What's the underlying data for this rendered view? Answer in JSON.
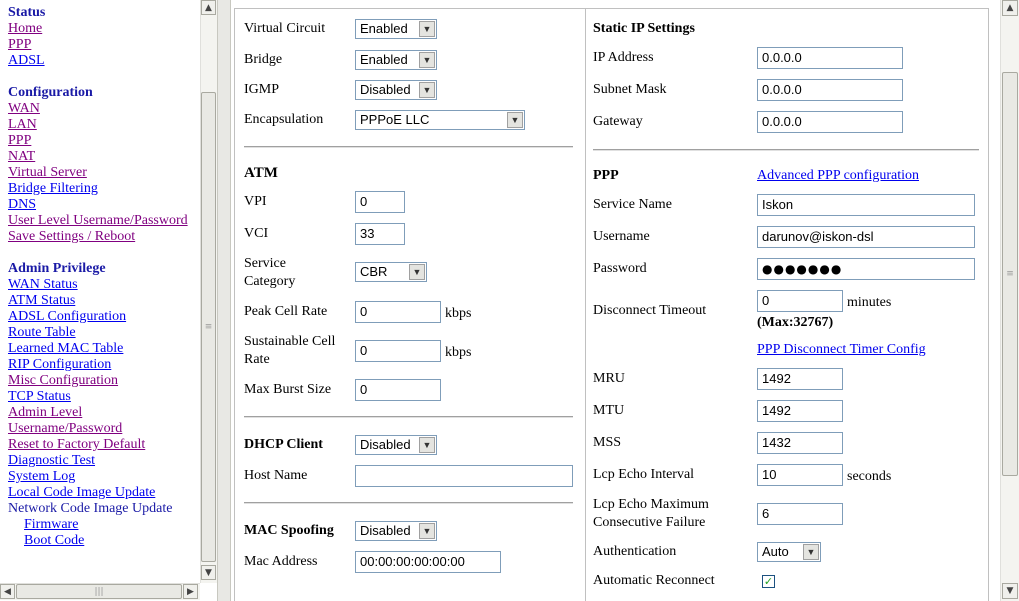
{
  "sidebar": {
    "status": {
      "title": "Status",
      "items": [
        "Home",
        "PPP",
        "ADSL"
      ]
    },
    "configuration": {
      "title": "Configuration",
      "items": [
        "WAN",
        "LAN",
        "PPP",
        "NAT",
        "Virtual Server",
        "Bridge Filtering",
        "DNS",
        "User Level Username/Password",
        "Save Settings / Reboot"
      ]
    },
    "admin": {
      "title": "Admin Privilege",
      "items": [
        "WAN Status",
        "ATM Status",
        "ADSL Configuration",
        "Route Table",
        "Learned MAC Table",
        "RIP Configuration",
        "Misc Configuration",
        "TCP Status",
        "Admin Level",
        "Username/Password",
        "Reset to Factory Default",
        "Diagnostic Test",
        "System Log",
        "Local Code Image Update",
        "Network Code Image Update"
      ],
      "subitems": [
        "Firmware",
        "Boot Code"
      ]
    }
  },
  "left_form": {
    "virtual_circuit": {
      "label": "Virtual Circuit",
      "value": "Enabled"
    },
    "bridge": {
      "label": "Bridge",
      "value": "Enabled"
    },
    "igmp": {
      "label": "IGMP",
      "value": "Disabled"
    },
    "encapsulation": {
      "label": "Encapsulation",
      "value": "PPPoE LLC"
    },
    "atm": {
      "title": "ATM",
      "vpi": {
        "label": "VPI",
        "value": "0"
      },
      "vci": {
        "label": "VCI",
        "value": "33"
      },
      "service_category": {
        "label_line1": "Service",
        "label_line2": "Category",
        "value": "CBR"
      },
      "peak_cell_rate": {
        "label": "Peak Cell Rate",
        "value": "0",
        "unit": "kbps"
      },
      "sustainable_cell_rate": {
        "label_line1": "Sustainable Cell",
        "label_line2": "Rate",
        "value": "0",
        "unit": "kbps"
      },
      "max_burst_size": {
        "label": "Max Burst Size",
        "value": "0"
      }
    },
    "dhcp": {
      "title": "DHCP Client",
      "value": "Disabled",
      "host_name_label": "Host Name",
      "host_name_value": ""
    },
    "mac": {
      "title": "MAC Spoofing",
      "value": "Disabled",
      "address_label": "Mac Address",
      "address_value": "00:00:00:00:00:00"
    }
  },
  "right_form": {
    "static_ip": {
      "title": "Static IP Settings",
      "ip_label": "IP Address",
      "ip_value": "0.0.0.0",
      "mask_label": "Subnet Mask",
      "mask_value": "0.0.0.0",
      "gateway_label": "Gateway",
      "gateway_value": "0.0.0.0"
    },
    "ppp": {
      "title": "PPP",
      "advanced_link": "Advanced PPP configuration",
      "service_name_label": "Service Name",
      "service_name_value": "Iskon",
      "username_label": "Username",
      "username_value": "darunov@iskon-dsl",
      "password_label": "Password",
      "password_value": "●●●●●●●",
      "disconnect_label": "Disconnect Timeout",
      "disconnect_value": "0",
      "disconnect_unit": "minutes",
      "disconnect_max": "(Max:32767)",
      "timer_link": "PPP Disconnect Timer Config",
      "mru_label": "MRU",
      "mru_value": "1492",
      "mtu_label": "MTU",
      "mtu_value": "1492",
      "mss_label": "MSS",
      "mss_value": "1432",
      "lcp_interval_label": "Lcp Echo Interval",
      "lcp_interval_value": "10",
      "lcp_interval_unit": "seconds",
      "lcp_max_label_line1": "Lcp Echo Maximum",
      "lcp_max_label_line2": "Consecutive Failure",
      "lcp_max_value": "6",
      "auth_label": "Authentication",
      "auth_value": "Auto",
      "reconnect_label": "Automatic Reconnect",
      "reconnect_checked": true
    }
  }
}
